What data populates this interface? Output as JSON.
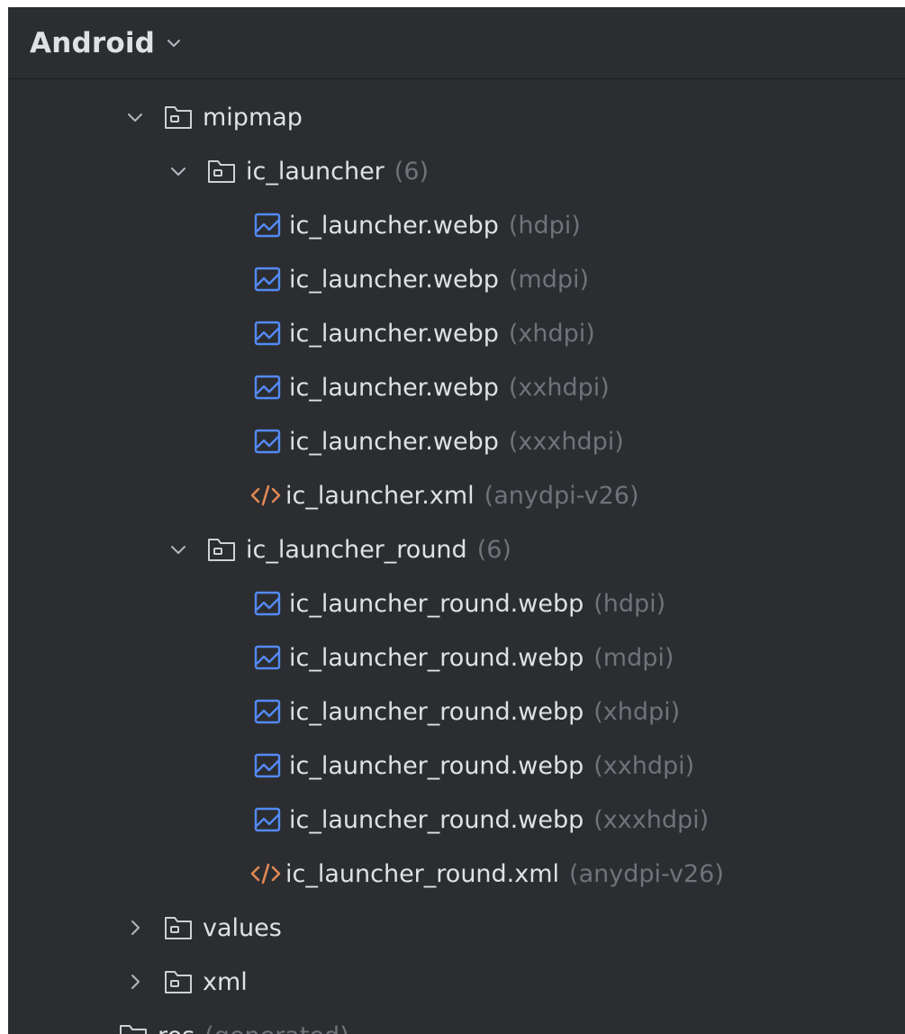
{
  "header": {
    "title": "Android",
    "dropdown_icon": "chevron-down-icon"
  },
  "tree": {
    "mipmap": {
      "label": "mipmap",
      "expanded": true
    },
    "ic_launcher": {
      "label": "ic_launcher",
      "count": "(6)",
      "expanded": true,
      "files": [
        {
          "name": "ic_launcher.webp",
          "qualifier": "(hdpi)",
          "type": "image"
        },
        {
          "name": "ic_launcher.webp",
          "qualifier": "(mdpi)",
          "type": "image"
        },
        {
          "name": "ic_launcher.webp",
          "qualifier": "(xhdpi)",
          "type": "image"
        },
        {
          "name": "ic_launcher.webp",
          "qualifier": "(xxhdpi)",
          "type": "image"
        },
        {
          "name": "ic_launcher.webp",
          "qualifier": "(xxxhdpi)",
          "type": "image"
        },
        {
          "name": "ic_launcher.xml",
          "qualifier": "(anydpi-v26)",
          "type": "xml"
        }
      ]
    },
    "ic_launcher_round": {
      "label": "ic_launcher_round",
      "count": "(6)",
      "expanded": true,
      "files": [
        {
          "name": "ic_launcher_round.webp",
          "qualifier": "(hdpi)",
          "type": "image"
        },
        {
          "name": "ic_launcher_round.webp",
          "qualifier": "(mdpi)",
          "type": "image"
        },
        {
          "name": "ic_launcher_round.webp",
          "qualifier": "(xhdpi)",
          "type": "image"
        },
        {
          "name": "ic_launcher_round.webp",
          "qualifier": "(xxhdpi)",
          "type": "image"
        },
        {
          "name": "ic_launcher_round.webp",
          "qualifier": "(xxxhdpi)",
          "type": "image"
        },
        {
          "name": "ic_launcher_round.xml",
          "qualifier": "(anydpi-v26)",
          "type": "xml"
        }
      ]
    },
    "values": {
      "label": "values",
      "expanded": false
    },
    "xml": {
      "label": "xml",
      "expanded": false
    },
    "res_generated": {
      "label": "res",
      "hint": "(generated)"
    }
  },
  "colors": {
    "background": "#2b2d30",
    "text": "#dfe1e5",
    "hint": "#6f737a",
    "image_icon": "#548af7",
    "xml_icon": "#e08855",
    "folder_icon": "#ced0d6"
  }
}
